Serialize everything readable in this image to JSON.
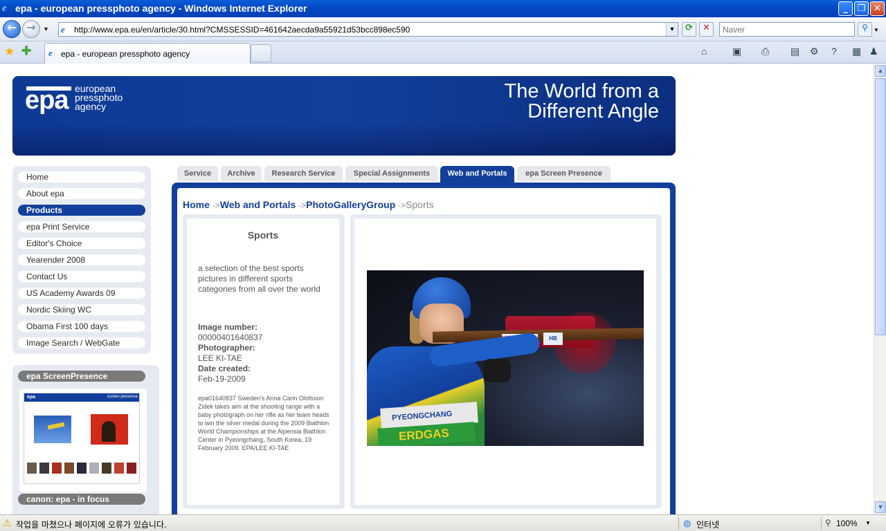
{
  "window": {
    "title": "epa - european pressphoto agency - Windows Internet Explorer",
    "minimize_glyph": "_",
    "restore_glyph": "❐",
    "close_glyph": "✕"
  },
  "navbar": {
    "url": "http://www.epa.eu/en/article/30.html?CMSSESSID=461642aecda9a55921d53bcc898ec590",
    "search_placeholder": "Naver"
  },
  "tabs": {
    "active_label": "epa - european pressphoto agency"
  },
  "header": {
    "logo": "epa",
    "logo_text": "european pressphoto agency",
    "slogan_line1": "The World from a",
    "slogan_line2": "Different Angle"
  },
  "leftnav": {
    "items": [
      {
        "label": "Home"
      },
      {
        "label": "About epa"
      },
      {
        "label": "Products"
      },
      {
        "label": "epa Print Service"
      },
      {
        "label": "Editor's Choice"
      },
      {
        "label": "Yearender 2008"
      },
      {
        "label": "Contact Us"
      },
      {
        "label": "US Academy Awards 09"
      },
      {
        "label": "Nordic Skiing WC"
      },
      {
        "label": "Obama First 100 days"
      },
      {
        "label": "Image Search / WebGate"
      }
    ],
    "active_index": 2
  },
  "screenpresence": {
    "title": "epa ScreenPresence",
    "next_title": "canon: epa - in focus",
    "mini_logo": "epa",
    "mini_title": "screen presence"
  },
  "content_tabs": [
    {
      "label": "Service"
    },
    {
      "label": "Archive"
    },
    {
      "label": "Research Service"
    },
    {
      "label": "Special Assignments"
    },
    {
      "label": "Web and Portals"
    },
    {
      "label": "epa Screen Presence"
    }
  ],
  "breadcrumb": {
    "home": "Home",
    "sep": "->",
    "web": "Web and Portals",
    "gallery": "PhotoGalleryGroup",
    "current": "Sports"
  },
  "info": {
    "title": "Sports",
    "description": "a selection of the best sports pictures in different sports categories from all over the world",
    "image_number_label": "Image number:",
    "image_number": "00000401640837",
    "photographer_label": "Photographer:",
    "photographer": "LEE KI-TAE",
    "date_label": "Date created:",
    "date": "Feb-19-2009",
    "caption": "epa01640837 Sweden's Anna Carin Olofsson Zidek takes aim at the shooting range with a baby photograph on her rifle as her team heads to win the silver medal during the 2009 Biathlon World Championships at the Alpensia Biathlon Center in Pyeongchang, South Korea, 19 February 2009. EPA/LEE KI-TAE"
  },
  "photo": {
    "sticker1": "VIESSMANN",
    "sticker2": "HB",
    "bib1": "PYEONGCHANG",
    "bib2": "ERDGAS"
  },
  "statusbar": {
    "message": "작업을 마쳤으나 페이지에 오류가 있습니다.",
    "zone": "인터넷",
    "zoom": "100%"
  }
}
